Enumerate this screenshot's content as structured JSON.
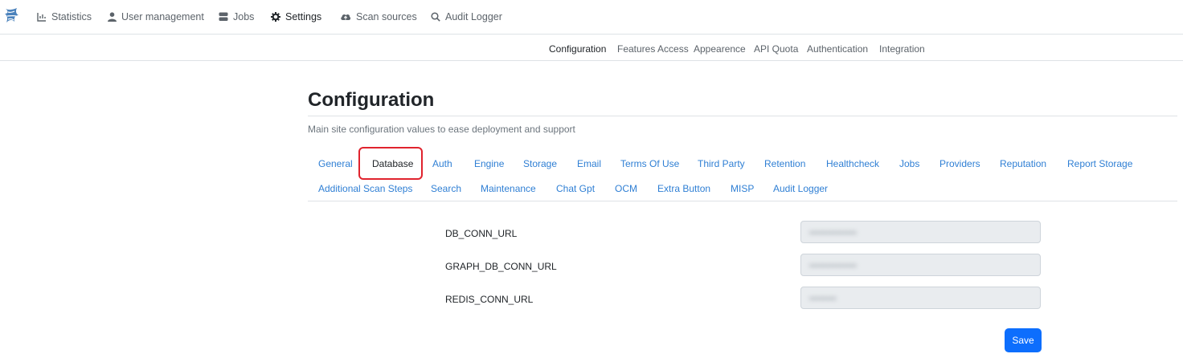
{
  "topnav": {
    "items": [
      {
        "label": "Statistics",
        "icon": "chart-icon"
      },
      {
        "label": "User management",
        "icon": "user-icon"
      },
      {
        "label": "Jobs",
        "icon": "database-icon"
      },
      {
        "label": "Settings",
        "icon": "gear-icon",
        "active": true
      },
      {
        "label": "Scan sources",
        "icon": "cloud-upload-icon"
      },
      {
        "label": "Audit Logger",
        "icon": "search-icon"
      }
    ]
  },
  "subnav": {
    "items": [
      {
        "label": "Configuration",
        "active": true
      },
      {
        "label": "Features Access"
      },
      {
        "label": "Appearence"
      },
      {
        "label": "API Quota"
      },
      {
        "label": "Authentication"
      },
      {
        "label": "Integration"
      }
    ]
  },
  "page": {
    "title": "Configuration",
    "subtitle": "Main site configuration values to ease deployment and support"
  },
  "tabs": {
    "row1": [
      "General",
      "Database",
      "Auth",
      "Engine",
      "Storage",
      "Email",
      "Terms Of Use",
      "Third Party",
      "Retention",
      "Healthcheck",
      "Jobs",
      "Providers",
      "Reputation",
      "Report Storage"
    ],
    "row2": [
      "Additional Scan Steps",
      "Search",
      "Maintenance",
      "Chat Gpt",
      "OCM",
      "Extra Button",
      "MISP",
      "Audit Logger"
    ],
    "active": "Database"
  },
  "fields": [
    {
      "label": "DB_CONN_URL",
      "value": "••••••••••••••"
    },
    {
      "label": "GRAPH_DB_CONN_URL",
      "value": "••••••••••••••"
    },
    {
      "label": "REDIS_CONN_URL",
      "value": "••••••••"
    }
  ],
  "actions": {
    "save_label": "Save"
  },
  "colors": {
    "accent": "#0d6efd",
    "link": "#2f7fd4",
    "highlight": "#e0232e"
  }
}
